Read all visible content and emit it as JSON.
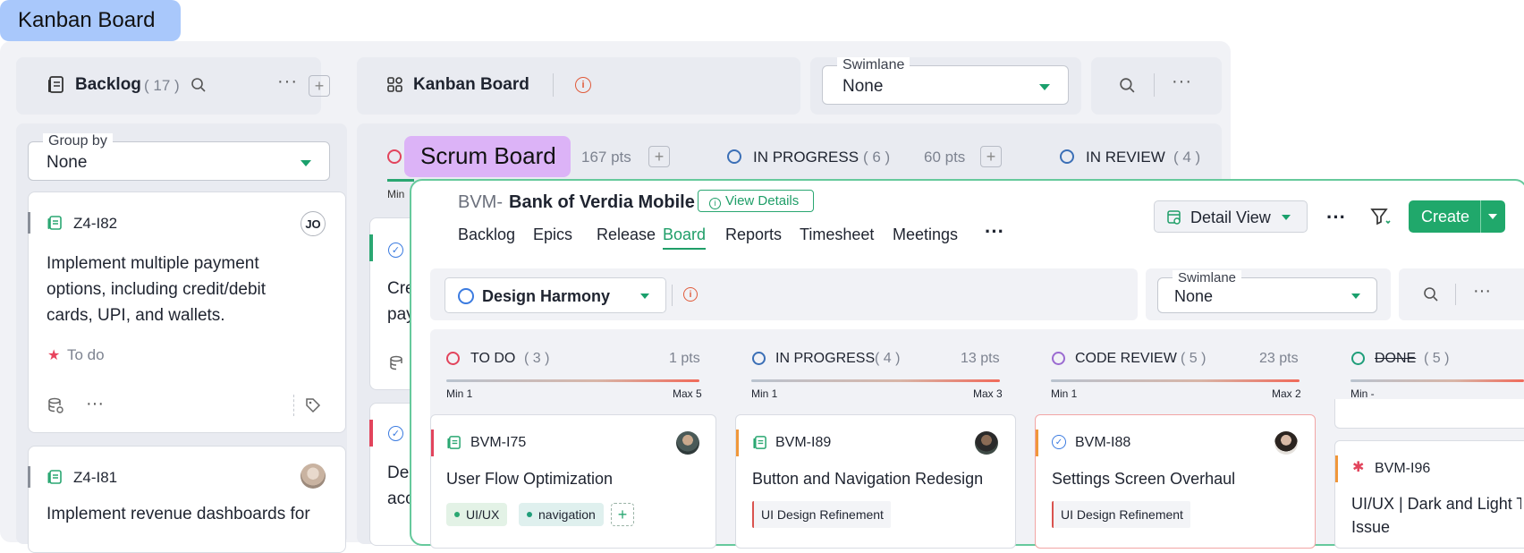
{
  "kanban": {
    "tag": "Kanban Board",
    "backlog": {
      "title": "Backlog",
      "count": "( 17 )"
    },
    "board_title": "Kanban Board",
    "swimlane": {
      "legend": "Swimlane",
      "value": "None"
    },
    "group_by": {
      "legend": "Group by",
      "value": "None"
    },
    "cards": [
      {
        "id": "Z4-I82",
        "avatar": "JO",
        "title": "Implement multiple payment options, including credit/debit cards, UPI, and wallets.",
        "status": "To do"
      },
      {
        "id": "Z4-I81",
        "title": "Implement revenue dashboards for"
      }
    ],
    "col_peek": {
      "min": "Min",
      "pts": "167 pts",
      "texts": [
        "Cre",
        "pay",
        "De",
        "acc"
      ]
    },
    "in_progress": {
      "title": "IN PROGRESS",
      "count": "( 6 )",
      "pts": "60 pts"
    },
    "in_review": {
      "title": "IN REVIEW",
      "count": "( 4 )"
    }
  },
  "scrum": {
    "tag": "Scrum Board",
    "project_prefix": "BVM-",
    "project_name": "Bank of Verdia Mobile",
    "view_details": "View Details",
    "nav": [
      "Backlog",
      "Epics",
      "Release",
      "Board",
      "Reports",
      "Timesheet",
      "Meetings"
    ],
    "active_nav": "Board",
    "detail_view": "Detail View",
    "create": "Create",
    "sprint": "Design Harmony",
    "swimlane": {
      "legend": "Swimlane",
      "value": "None"
    },
    "columns": [
      {
        "title": "TO DO",
        "count": "( 3 )",
        "pts": "1 pts",
        "min": "Min 1",
        "max": "Max 5",
        "color": "#e2445c"
      },
      {
        "title": "IN PROGRESS",
        "count": "( 4 )",
        "pts": "13 pts",
        "min": "Min 1",
        "max": "Max 3",
        "color": "#3b6fb6"
      },
      {
        "title": "CODE REVIEW",
        "count": "( 5 )",
        "pts": "23 pts",
        "min": "Min 1",
        "max": "Max 2",
        "color": "#9b6bd1"
      },
      {
        "title": "DONE",
        "count": "( 5 )",
        "pts": "",
        "min": "Min -",
        "max": "",
        "color": "#1f9e7a"
      }
    ],
    "cards": [
      {
        "id": "BVM-I75",
        "title": "User Flow Optimization",
        "tags": [
          "UI/UX",
          "navigation"
        ]
      },
      {
        "id": "BVM-I89",
        "title": "Button and Navigation Redesign",
        "tag": "UI Design Refinement"
      },
      {
        "id": "BVM-I88",
        "title": "Settings Screen Overhaul",
        "tag": "UI Design Refinement"
      },
      {
        "id": "BVM-I96",
        "title": "UI/UX | Dark and Light T",
        "title2": "Issue"
      }
    ]
  }
}
